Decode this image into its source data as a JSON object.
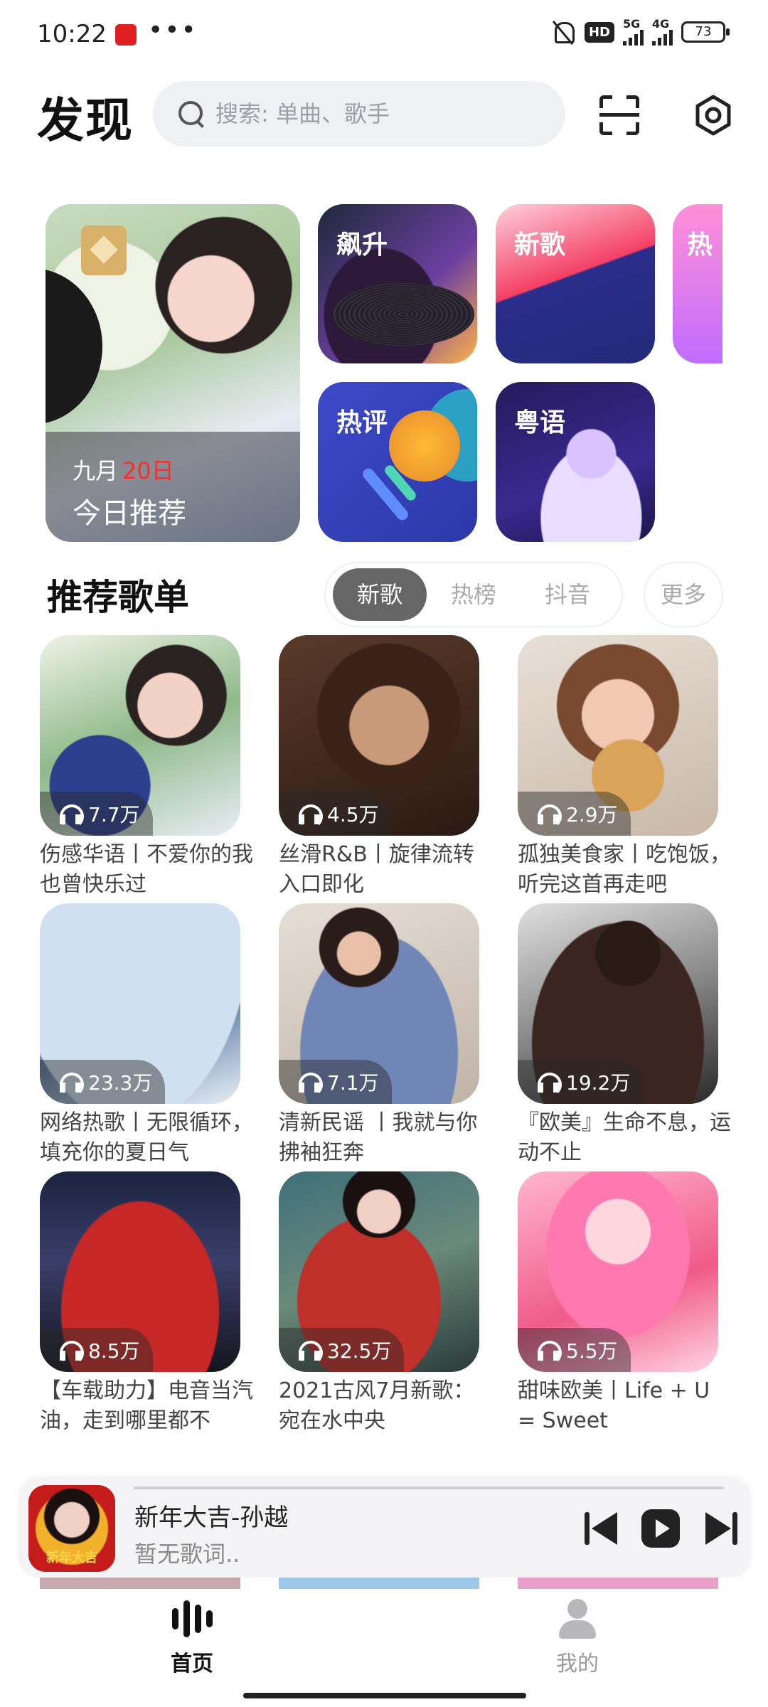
{
  "status_bar": {
    "time": "10:22",
    "dots": "•••",
    "hd_label": "HD",
    "sig1_label": "5G",
    "sig2_label": "4G",
    "battery": "73"
  },
  "header": {
    "title": "发现",
    "search_placeholder": "搜索: 单曲、歌手"
  },
  "featured": {
    "daily": {
      "month": "九月",
      "day": "20日",
      "label": "今日推荐"
    },
    "tiles": [
      {
        "label": "飙升"
      },
      {
        "label": "新歌"
      },
      {
        "label": "热"
      },
      {
        "label": "热评"
      },
      {
        "label": "粤语"
      }
    ]
  },
  "section": {
    "title": "推荐歌单",
    "tabs": [
      {
        "label": "新歌",
        "active": true
      },
      {
        "label": "热榜",
        "active": false
      },
      {
        "label": "抖音",
        "active": false
      }
    ],
    "more": "更多"
  },
  "playlists": [
    {
      "plays": "7.7万",
      "title": "伤感华语丨不爱你的我也曾快乐过"
    },
    {
      "plays": "4.5万",
      "title": "丝滑R&B丨旋律流转入口即化"
    },
    {
      "plays": "2.9万",
      "title": "孤独美食家丨吃饱饭，听完这首再走吧"
    },
    {
      "plays": "23.3万",
      "title": "网络热歌丨无限循环，填充你的夏日气"
    },
    {
      "plays": "7.1万",
      "title": "清新民谣 丨我就与你拂袖狂奔"
    },
    {
      "plays": "19.2万",
      "title": "『欧美』生命不息，运动不止"
    },
    {
      "plays": "8.5万",
      "title": "【车载助力】电音当汽油，走到哪里都不"
    },
    {
      "plays": "32.5万",
      "title": "2021古风7月新歌：宛在水中央"
    },
    {
      "plays": "5.5万",
      "title": "甜味欧美丨Life + U = Sweet"
    }
  ],
  "player": {
    "art_text": "新年大吉",
    "song": "新年大吉-孙越",
    "lyric": "暂无歌词.."
  },
  "nav": {
    "home": "首页",
    "mine": "我的"
  },
  "colors": {
    "accent_red": "#ff2a2a",
    "active_tab": "#666666",
    "text_primary": "#111111"
  }
}
